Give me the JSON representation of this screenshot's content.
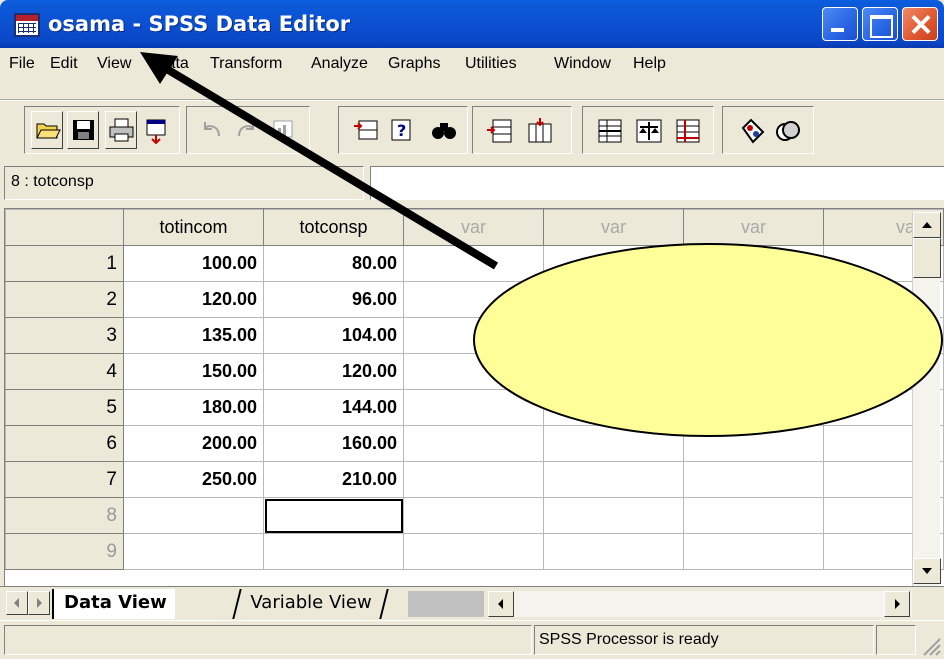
{
  "window": {
    "title": "osama - SPSS Data Editor"
  },
  "menu": [
    "File",
    "Edit",
    "View",
    "Data",
    "Transform",
    "Analyze",
    "Graphs",
    "Utilities",
    "Window",
    "Help"
  ],
  "cellbar": {
    "reference": "8 : totconsp",
    "value": ""
  },
  "grid": {
    "columns": [
      "totincom",
      "totconsp",
      "var",
      "var",
      "var",
      "var"
    ],
    "rows": [
      {
        "num": "1",
        "totincom": "100.00",
        "totconsp": "80.00"
      },
      {
        "num": "2",
        "totincom": "120.00",
        "totconsp": "96.00"
      },
      {
        "num": "3",
        "totincom": "135.00",
        "totconsp": "104.00"
      },
      {
        "num": "4",
        "totincom": "150.00",
        "totconsp": "120.00"
      },
      {
        "num": "5",
        "totincom": "180.00",
        "totconsp": "144.00"
      },
      {
        "num": "6",
        "totincom": "200.00",
        "totconsp": "160.00"
      },
      {
        "num": "7",
        "totincom": "250.00",
        "totconsp": "210.00"
      },
      {
        "num": "8",
        "totincom": "",
        "totconsp": ""
      },
      {
        "num": "9",
        "totincom": "",
        "totconsp": ""
      }
    ],
    "selected_cell": "8 : totconsp"
  },
  "tabs": {
    "data_view": "Data View",
    "variable_view": "Variable View"
  },
  "status": {
    "processor": "SPSS Processor  is ready"
  },
  "annotation": {
    "callout_color": "#ffff99",
    "arrow_color": "#000000"
  },
  "colors": {
    "titlebar": "#0b4fd0",
    "chrome": "#ece9d8",
    "close_button": "#e05a32"
  }
}
